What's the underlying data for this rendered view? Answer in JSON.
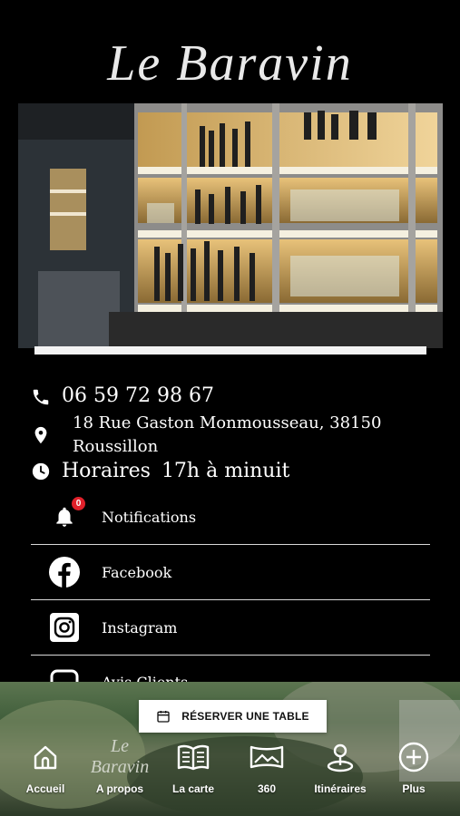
{
  "brand": {
    "logo_text": "Le Baravin",
    "nav_logo_text": "Le Baravin"
  },
  "contact": {
    "phone": "06 59 72 98 67",
    "address_line1": "18 Rue Gaston Monmousseau, 38150",
    "address_line2": "Roussillon",
    "hours_label": "Horaires",
    "hours_value": "17h à minuit"
  },
  "links": [
    {
      "label": "Notifications",
      "icon": "bell-icon",
      "badge": "0"
    },
    {
      "label": "Facebook",
      "icon": "facebook-icon"
    },
    {
      "label": "Instagram",
      "icon": "instagram-icon"
    },
    {
      "label": "Avis Clients",
      "icon": "reviews-icon"
    }
  ],
  "reserve_button": {
    "label": "RÉSERVER UNE TABLE",
    "icon": "calendar-icon"
  },
  "bottom_nav": [
    {
      "label": "Accueil",
      "icon": "home-icon"
    },
    {
      "label": "A propos",
      "icon": "logo-icon"
    },
    {
      "label": "La carte",
      "icon": "book-icon"
    },
    {
      "label": "360",
      "icon": "panorama-icon"
    },
    {
      "label": "Itinéraires",
      "icon": "map-pin-icon"
    },
    {
      "label": "Plus",
      "icon": "plus-circle-icon"
    }
  ],
  "colors": {
    "background": "#000000",
    "badge": "#e0202a",
    "shelf_light": "#e0b45c"
  }
}
